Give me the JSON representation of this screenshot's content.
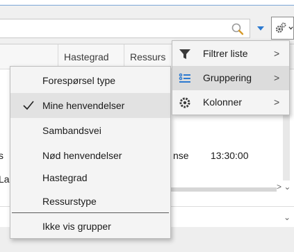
{
  "toolbar": {
    "search_placeholder": "",
    "filter_caret": "▼",
    "settings_caret": "⌄"
  },
  "grid": {
    "columns": [
      "Hastegrad",
      "Ressurs"
    ],
    "row": {
      "left_partial": "s",
      "type_partial": "nse",
      "time": "13:30:00"
    },
    "row2_left_partial": "La"
  },
  "group_menu": {
    "items": [
      {
        "label": "Forespørsel type",
        "checked": false
      },
      {
        "label": "Mine henvendelser",
        "checked": true
      },
      {
        "label": "Sambandsvei",
        "checked": false
      },
      {
        "label": "Nød henvendelser",
        "checked": false
      },
      {
        "label": "Hastegrad",
        "checked": false
      },
      {
        "label": "Ressurstype",
        "checked": false
      }
    ],
    "footer_item": "Ikke vis grupper"
  },
  "settings_menu": {
    "items": [
      {
        "label": "Filtrer liste",
        "icon": "funnel-icon",
        "arrow": ">"
      },
      {
        "label": "Gruppering",
        "icon": "grouping-list-icon",
        "arrow": ">"
      },
      {
        "label": "Kolonner",
        "icon": "gear-icon",
        "arrow": ">"
      }
    ]
  },
  "colors": {
    "accent_blue": "#2b79d0",
    "menu_background": "#f4f4f4",
    "selected_background": "#dcdcdc"
  }
}
